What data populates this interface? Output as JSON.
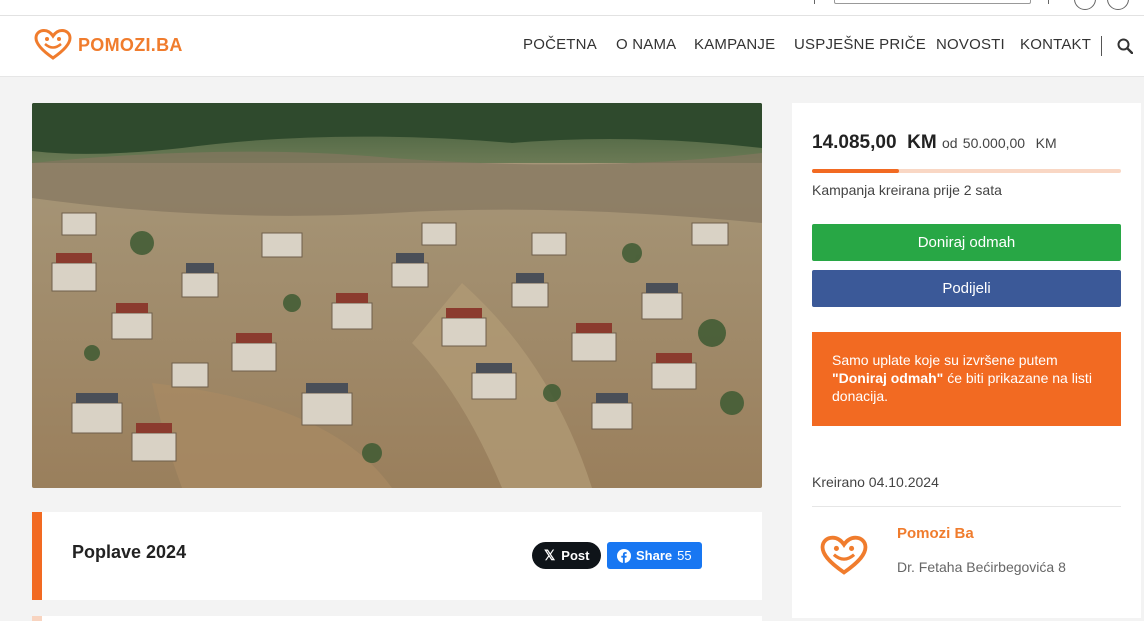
{
  "brand": {
    "name": "POMOZI.BA",
    "color": "#f07c2d",
    "logo_icon": "heart-logo-icon"
  },
  "nav": {
    "items": [
      "POČETNA",
      "O NAMA",
      "KAMPANJE",
      "USPJEŠNE PRIČE",
      "NOVOSTI",
      "KONTAKT"
    ],
    "search_icon": "search-icon"
  },
  "campaign": {
    "image_alt": "Aerial view of flooded town",
    "title": "Poplave 2024",
    "share_x_label": "Post",
    "share_fb_label": "Share",
    "share_fb_count": "55"
  },
  "sidebar": {
    "raised": "14.085,00",
    "currency": "KM",
    "of_label": "od",
    "goal": "50.000,00",
    "goal_currency": "KM",
    "progress_fraction": 0.28,
    "created_ago": "Kampanja kreirana prije 2 sata",
    "donate_label": "Doniraj odmah",
    "share_label": "Podijeli",
    "notice_pre": "Samo uplate koje su izvršene putem",
    "notice_bold": "\"Doniraj odmah\"",
    "notice_post": "će biti prikazane na listi donacija.",
    "created_date": "Kreirano 04.10.2024",
    "org_name": "Pomozi Ba",
    "org_address": "Dr. Fetaha Bećirbegovića 8"
  },
  "colors": {
    "accent": "#f26a22",
    "donate_green": "#28a745",
    "share_blue": "#3b5998",
    "fb_blue": "#1877f2",
    "x_black": "#0f1419"
  }
}
